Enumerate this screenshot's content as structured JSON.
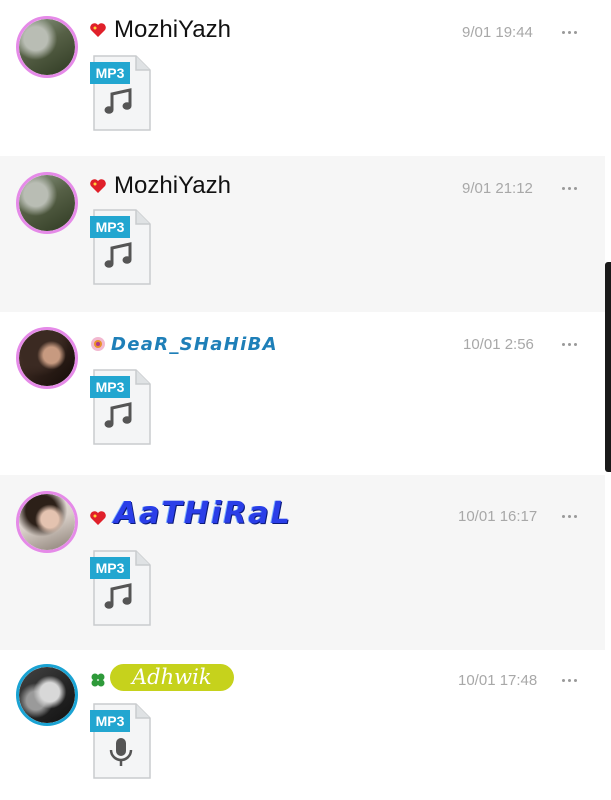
{
  "colors": {
    "accent_ring": "#e58ae8",
    "ring_teal": "#1aa3d3",
    "mp3_tag": "#22a6d0",
    "timestamp": "#a8a8a8",
    "alt_row": "#f6f6f6"
  },
  "posts": [
    {
      "badge_icon": "heart-icon",
      "name": "MozhiYazh",
      "time": "9/01 19:44",
      "file_tag": "MP3",
      "file_icon": "music-note-icon"
    },
    {
      "badge_icon": "heart-icon",
      "name": "MozhiYazh",
      "time": "9/01 21:12",
      "file_tag": "MP3",
      "file_icon": "music-note-icon"
    },
    {
      "badge_icon": "flower-icon",
      "name": "DeaR_SHaHiBA",
      "time": "10/01 2:56",
      "file_tag": "MP3",
      "file_icon": "music-note-icon"
    },
    {
      "badge_icon": "heart-icon",
      "name": "AaTHiRaL",
      "time": "10/01 16:17",
      "file_tag": "MP3",
      "file_icon": "music-note-icon"
    },
    {
      "badge_icon": "clover-icon",
      "name": "Adhwik",
      "time": "10/01 17:48",
      "file_tag": "MP3",
      "file_icon": "microphone-icon"
    }
  ]
}
